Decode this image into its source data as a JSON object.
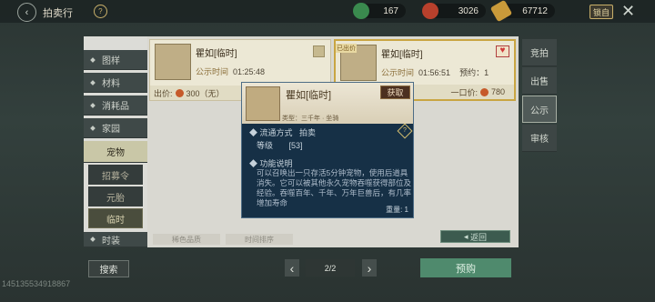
{
  "header": {
    "title": "拍卖行",
    "help": "?"
  },
  "resources": [
    {
      "name": "jade",
      "value": "167",
      "color": "#3a8a4e"
    },
    {
      "name": "red-gem",
      "value": "3026",
      "color": "#b8402c"
    },
    {
      "name": "gold",
      "value": "67712",
      "color": "#c99a3a"
    }
  ],
  "lock_label": "锁自",
  "left_tabs": [
    "图样",
    "材料",
    "消耗品",
    "家园",
    "宠物"
  ],
  "sub_tabs": [
    "招募令",
    "元胎",
    "临时"
  ],
  "last_tab": "时装",
  "right_tabs": [
    "竞拍",
    "出售",
    "公示",
    "审核"
  ],
  "cards": [
    {
      "name": "瞿如[临时]",
      "time_label": "公示时间",
      "time": "01:25:48",
      "price_label": "出价:",
      "price": "300（无）"
    },
    {
      "name": "瞿如[临时]",
      "time_label": "公示时间",
      "time": "01:56:51",
      "extra": "预约：1",
      "price_label": "一口价:",
      "price": "780",
      "ribbon": "已出价"
    }
  ],
  "tooltip": {
    "name": "瞿如[临时]",
    "button": "获取",
    "type": "类型：三千年 · 坐骑",
    "row1_label": "流通方式",
    "row1_value": "拍卖",
    "row2_label": "等级",
    "row2_value": "[53]",
    "desc_label": "功能说明",
    "desc": "可以召唤出一只存活5分钟宠物，使用后道具消失。它可以被其他永久宠物吞噬获得部位及经验。吞噬百年、千年、万年巨兽后，有几率增加寿命",
    "weight": "重量: 1"
  },
  "filters": [
    "稀色品质",
    "时间排序"
  ],
  "return_label": "返回",
  "search_label": "搜索",
  "page": "2/2",
  "reserve_label": "预购",
  "uid": "1451355349​18867"
}
